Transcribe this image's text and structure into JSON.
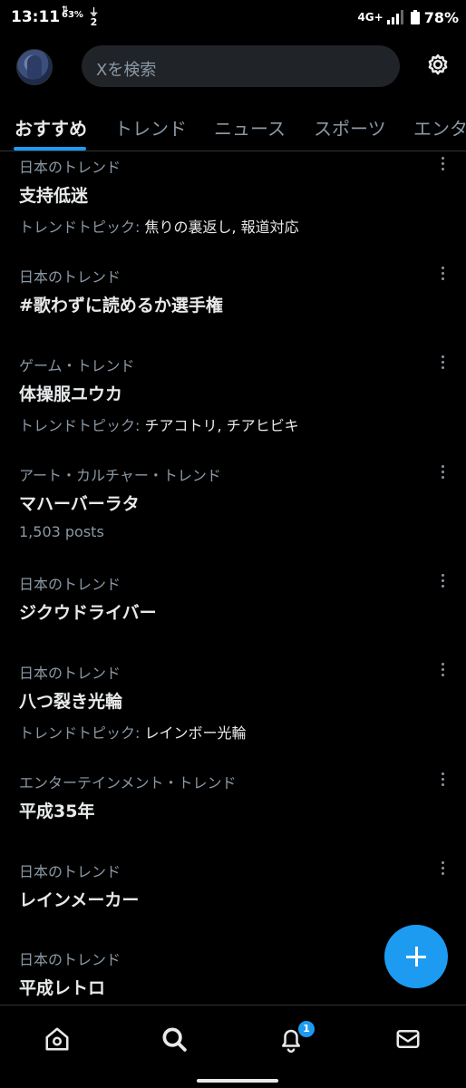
{
  "status_bar": {
    "time": "13:11",
    "data_indicator": "63%",
    "usb_indicator": "2",
    "network": "4G+",
    "battery": "78%"
  },
  "header": {
    "search_placeholder": "Xを検索"
  },
  "tabs": [
    "おすすめ",
    "トレンド",
    "ニュース",
    "スポーツ",
    "エンタ"
  ],
  "trends": [
    {
      "category": "日本のトレンド",
      "name": "支持低迷",
      "meta_label": "トレンドトピック:",
      "meta_value": "焦りの裏返し, 報道対応",
      "posts": ""
    },
    {
      "category": "日本のトレンド",
      "name": "#歌わずに読めるか選手権",
      "meta_label": "",
      "meta_value": "",
      "posts": ""
    },
    {
      "category": "ゲーム・トレンド",
      "name": "体操服ユウカ",
      "meta_label": "トレンドトピック:",
      "meta_value": "チアコトリ, チアヒビキ",
      "posts": ""
    },
    {
      "category": "アート・カルチャー・トレンド",
      "name": "マハーバーラタ",
      "meta_label": "",
      "meta_value": "",
      "posts": "1,503 posts"
    },
    {
      "category": "日本のトレンド",
      "name": "ジクウドライバー",
      "meta_label": "",
      "meta_value": "",
      "posts": ""
    },
    {
      "category": "日本のトレンド",
      "name": "八つ裂き光輪",
      "meta_label": "トレンドトピック:",
      "meta_value": "レインボー光輪",
      "posts": ""
    },
    {
      "category": "エンターテインメント・トレンド",
      "name": "平成35年",
      "meta_label": "",
      "meta_value": "",
      "posts": ""
    },
    {
      "category": "日本のトレンド",
      "name": "レインメーカー",
      "meta_label": "",
      "meta_value": "",
      "posts": ""
    },
    {
      "category": "日本のトレンド",
      "name": "平成レトロ",
      "meta_label": "",
      "meta_value": "",
      "posts": ""
    }
  ],
  "bottom_nav": {
    "items": [
      "home-icon",
      "search-icon",
      "notifications-icon",
      "messages-icon"
    ],
    "notification_count": "1"
  },
  "colors": {
    "accent": "#1d9bf0",
    "background": "#000000",
    "secondary_text": "#8b98a5",
    "primary_text": "#e7e9ea"
  }
}
